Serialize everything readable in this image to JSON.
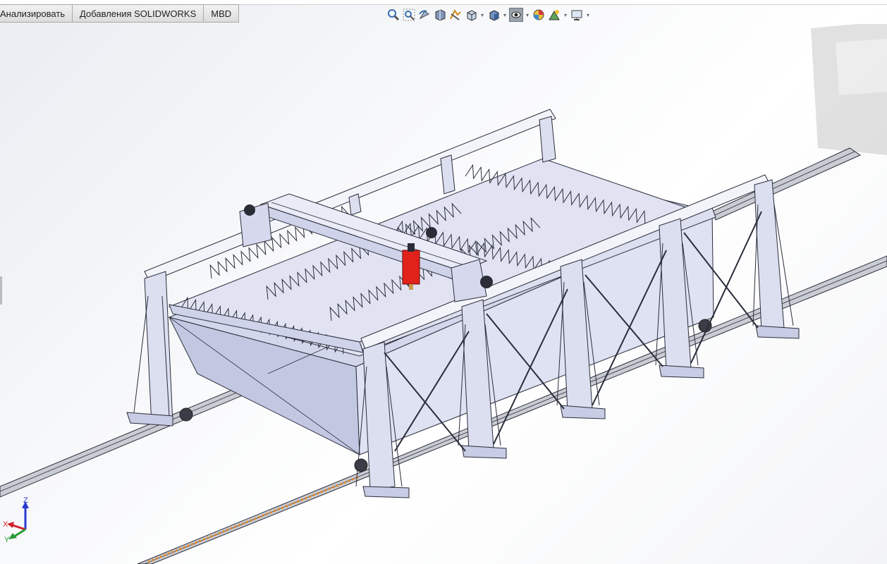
{
  "tabs": [
    {
      "label": "Анализировать"
    },
    {
      "label": "Добавления SOLIDWORKS"
    },
    {
      "label": "MBD"
    }
  ],
  "heads_up_toolbar": {
    "items": [
      "zoom-to-fit-icon",
      "zoom-to-area-icon",
      "previous-view-icon",
      "section-view-icon",
      "dynamic-annotation-icon",
      "view-orientation-icon",
      "display-style-icon",
      "hide-show-items-icon",
      "edit-appearance-icon",
      "apply-scene-icon",
      "view-settings-icon"
    ],
    "active_item": "hide-show-items-icon"
  },
  "triad": {
    "x_label": "X",
    "y_label": "Y",
    "z_label": "Z"
  },
  "colors": {
    "frame": "#dcdff0",
    "frame_edge": "#2a2d3a",
    "torch": "#e0221b",
    "rail_stripe": "#e38a2a",
    "triad_x": "#d0202a",
    "triad_y": "#2a9a35",
    "triad_z": "#2a3ad0"
  }
}
